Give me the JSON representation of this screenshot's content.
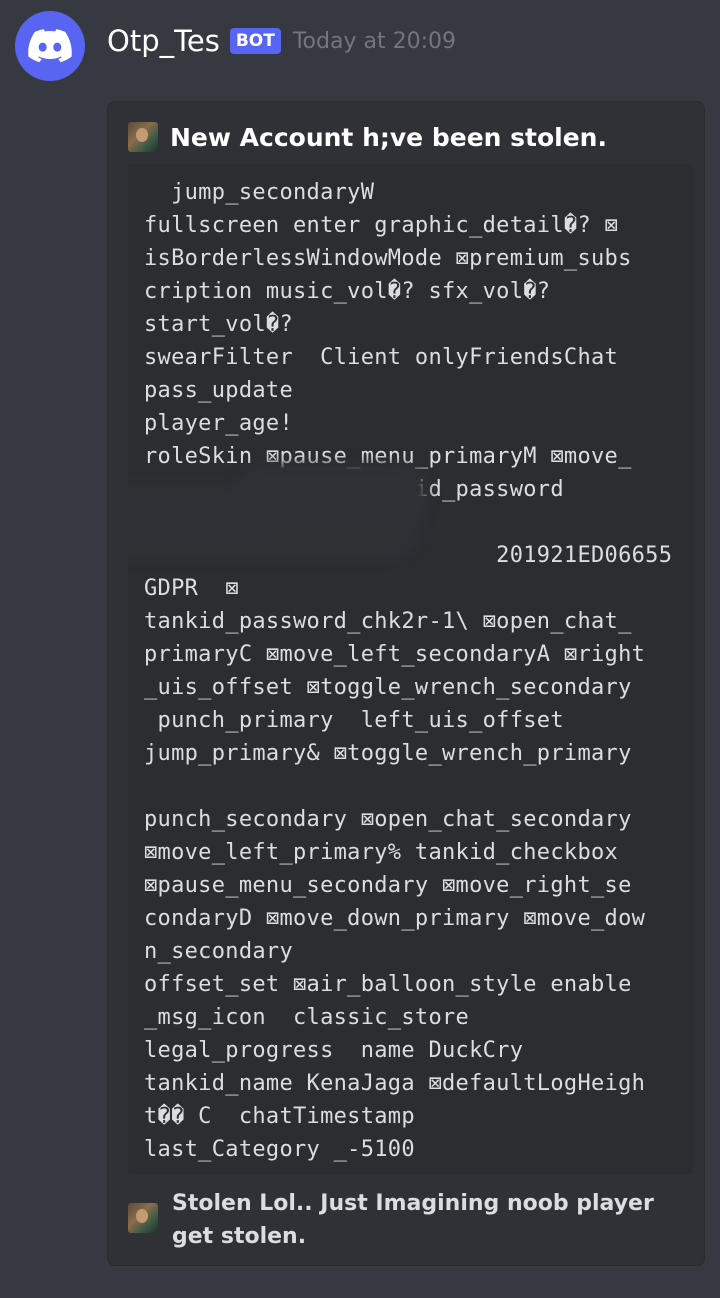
{
  "message": {
    "username": "Otp_Tes",
    "badge": "BOT",
    "timestamp": "Today at 20:09",
    "avatar_icon": "discord-logo-icon",
    "accent_color": "#5865f2"
  },
  "embed": {
    "author_name": "New Account h;ve been stolen.",
    "code_lines": [
      "  jump_secondaryW",
      "fullscreen enter graphic_detail�? ⊠",
      "isBorderlessWindowMode ⊠premium_subs",
      "cription music_vol�? sfx_vol�?",
      "start_vol�?",
      "swearFilter  Client onlyFriendsChat",
      "pass_update",
      "player_age!",
      "roleSkin ⊠pause_menu_primaryM ⊠move_",
      "                tankid_password",
      "",
      "                          201921ED06655",
      "GDPR  ⊠",
      "tankid_password_chk2r-1\\ ⊠open_chat_",
      "primaryC ⊠move_left_secondaryA ⊠right",
      "_uis_offset ⊠toggle_wrench_secondary",
      " punch_primary  left_uis_offset",
      "jump_primary& ⊠toggle_wrench_primary",
      "",
      "punch_secondary ⊠open_chat_secondary",
      "⊠move_left_primary% tankid_checkbox",
      "⊠pause_menu_secondary ⊠move_right_se",
      "condaryD ⊠move_down_primary ⊠move_dow",
      "n_secondary",
      "offset_set ⊠air_balloon_style enable",
      "_msg_icon  classic_store",
      "legal_progress  name DuckCry",
      "tankid_name KenaJaga ⊠defaultLogHeigh",
      "t�� C  chatTimestamp",
      "last_Category _-5100"
    ],
    "footer_text": "Stolen Lol.. Just Imagining noob player get stolen."
  }
}
